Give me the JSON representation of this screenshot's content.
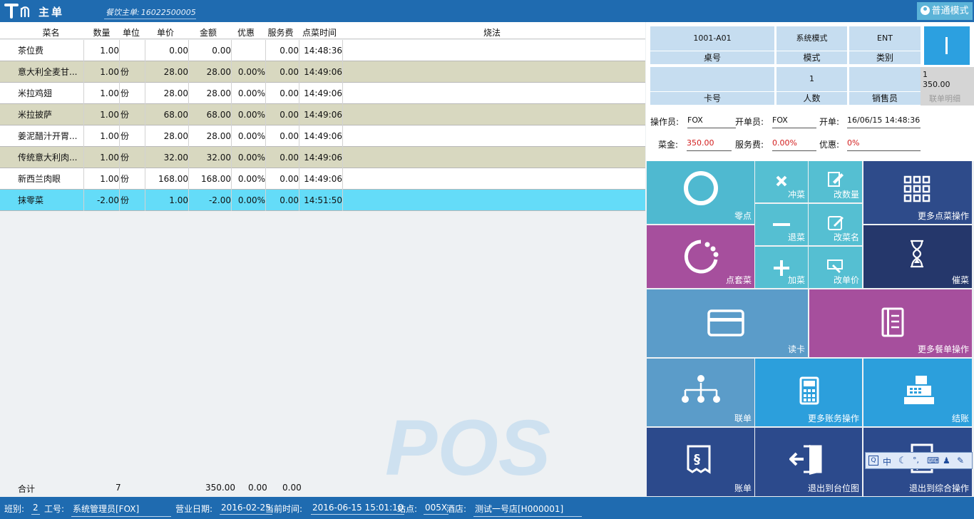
{
  "window": {
    "title": "主单",
    "order_label": "餐饮主单:",
    "order_no": "16022500005",
    "mode_button": "普通模式"
  },
  "table": {
    "columns": [
      "菜名",
      "数量",
      "单位",
      "单价",
      "金额",
      "优惠",
      "服务费",
      "点菜时间",
      "烧法"
    ],
    "rows": [
      {
        "name": "茶位费",
        "qty": "1.00",
        "unit": "",
        "price": "0.00",
        "amount": "0.00",
        "disc": "",
        "svc": "0.00",
        "time": "14:48:36"
      },
      {
        "name": "意大利全麦甘...",
        "qty": "1.00",
        "unit": "份",
        "price": "28.00",
        "amount": "28.00",
        "disc": "0.00%",
        "svc": "0.00",
        "time": "14:49:06"
      },
      {
        "name": "米拉鸡翅",
        "qty": "1.00",
        "unit": "份",
        "price": "28.00",
        "amount": "28.00",
        "disc": "0.00%",
        "svc": "0.00",
        "time": "14:49:06"
      },
      {
        "name": "米拉披萨",
        "qty": "1.00",
        "unit": "份",
        "price": "68.00",
        "amount": "68.00",
        "disc": "0.00%",
        "svc": "0.00",
        "time": "14:49:06"
      },
      {
        "name": "姜泥醋汁开胃...",
        "qty": "1.00",
        "unit": "份",
        "price": "28.00",
        "amount": "28.00",
        "disc": "0.00%",
        "svc": "0.00",
        "time": "14:49:06"
      },
      {
        "name": "传统意大利肉...",
        "qty": "1.00",
        "unit": "份",
        "price": "32.00",
        "amount": "32.00",
        "disc": "0.00%",
        "svc": "0.00",
        "time": "14:49:06"
      },
      {
        "name": "新西兰肉眼",
        "qty": "1.00",
        "unit": "份",
        "price": "168.00",
        "amount": "168.00",
        "disc": "0.00%",
        "svc": "0.00",
        "time": "14:49:06"
      },
      {
        "name": "抹零菜",
        "qty": "-2.00",
        "unit": "份",
        "price": "1.00",
        "amount": "-2.00",
        "disc": "0.00%",
        "svc": "0.00",
        "time": "14:51:50"
      }
    ],
    "row_colors": [
      "#ffffff",
      "#d8d8c0",
      "#ffffff",
      "#d8d8c0",
      "#ffffff",
      "#d8d8c0",
      "#ffffff",
      "#64dcf8"
    ],
    "totals": {
      "label": "合计",
      "qty": "7",
      "amount": "350.00",
      "disc": "0.00",
      "svc": "0.00"
    },
    "watermark": "POS"
  },
  "info": {
    "table_no": "1001-A01",
    "table_label": "桌号",
    "mode_value": "系统模式",
    "mode_label": "模式",
    "type_value": "ENT",
    "type_label": "类别",
    "card_value": "",
    "card_label": "卡号",
    "people_value": "1",
    "people_label": "人数",
    "sales_value": "",
    "sales_label": "销售员",
    "card_detail_line1": "1",
    "card_detail_line2": "350.00",
    "card_detail_label": "联单明细",
    "operator_label": "操作员:",
    "operator": "FOX",
    "opener_label": "开单员:",
    "opener": "FOX",
    "open_label": "开单:",
    "open_time": "16/06/15 14:48:36",
    "dish_label": "菜金:",
    "dish_amount": "350.00",
    "service_label": "服务费:",
    "service": "0.00%",
    "discount_label": "优惠:",
    "discount": "0%"
  },
  "tiles": {
    "t_lingdian": "零点",
    "t_chongcai": "冲菜",
    "t_gaishuliang": "改数量",
    "t_gengduo": "更多点菜操作",
    "t_tuicai": "退菜",
    "t_gaicaiming": "改菜名",
    "t_taocai": "点套菜",
    "t_jiacai": "加菜",
    "t_gaidanjia": "改单价",
    "t_cuicai": "催菜",
    "t_duka": "读卡",
    "t_canshan": "更多餐单操作",
    "t_liandan": "联单",
    "t_zhangwu": "更多账务操作",
    "t_jiezhang": "结账",
    "t_zhangdan": "账单",
    "t_taiwei": "退出到台位图",
    "t_zonghe": "退出到综合操作"
  },
  "ime": {
    "mode": "中"
  },
  "status": {
    "shift_label": "班别:",
    "shift": "2",
    "staff_label": "工号:",
    "staff": "系统管理员[FOX]",
    "bizdate_label": "营业日期:",
    "bizdate": "2016-02-25",
    "now_label": "当前时间:",
    "now": "2016-06-15 15:01:10",
    "station_label": "站点:",
    "station": "005X",
    "hotel_label": "酒店:",
    "hotel": "测试一号店[H000001]"
  }
}
